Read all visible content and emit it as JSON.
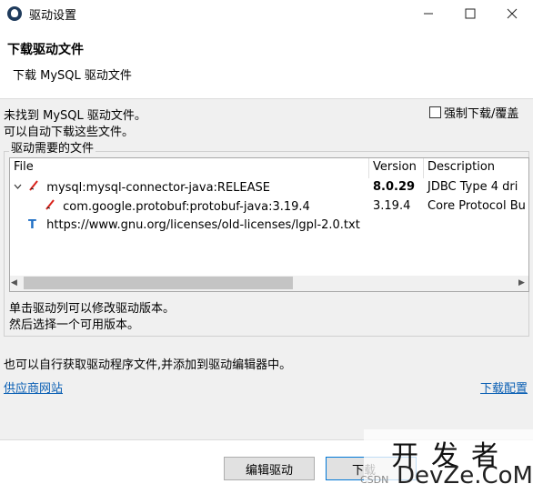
{
  "window": {
    "title": "驱动设置"
  },
  "header": {
    "title": "下载驱动文件",
    "subtitle": "下载 MySQL 驱动文件"
  },
  "body": {
    "message_line1": "未找到 MySQL 驱动文件。",
    "message_line2": "可以自动下载这些文件。",
    "force_download_label": "强制下载/覆盖",
    "group_label": "驱动需要的文件",
    "columns": {
      "file": "File",
      "version": "Version",
      "description": "Description"
    },
    "rows": [
      {
        "file": "mysql:mysql-connector-java:RELEASE",
        "version": "8.0.29",
        "description": "JDBC Type 4 dri"
      },
      {
        "file": "com.google.protobuf:protobuf-java:3.19.4",
        "version": "3.19.4",
        "description": "Core Protocol Bu"
      },
      {
        "file": "https://www.gnu.org/licenses/old-licenses/lgpl-2.0.txt",
        "version": "",
        "description": ""
      }
    ],
    "note_line1": "单击驱动列可以修改驱动版本。",
    "note_line2": "然后选择一个可用版本。",
    "manual_text": "也可以自行获取驱动程序文件,并添加到驱动编辑器中。",
    "vendor_link": "供应商网站",
    "config_link": "下载配置"
  },
  "footer": {
    "edit_button": "编辑驱动",
    "download_button": "下载"
  },
  "watermark": {
    "top": "开发者",
    "bottom": "DevZe.CoM",
    "small": "CSDN"
  },
  "icons": {
    "app": "dbeaver-icon",
    "jar": "jar-icon",
    "license": "text-icon"
  }
}
